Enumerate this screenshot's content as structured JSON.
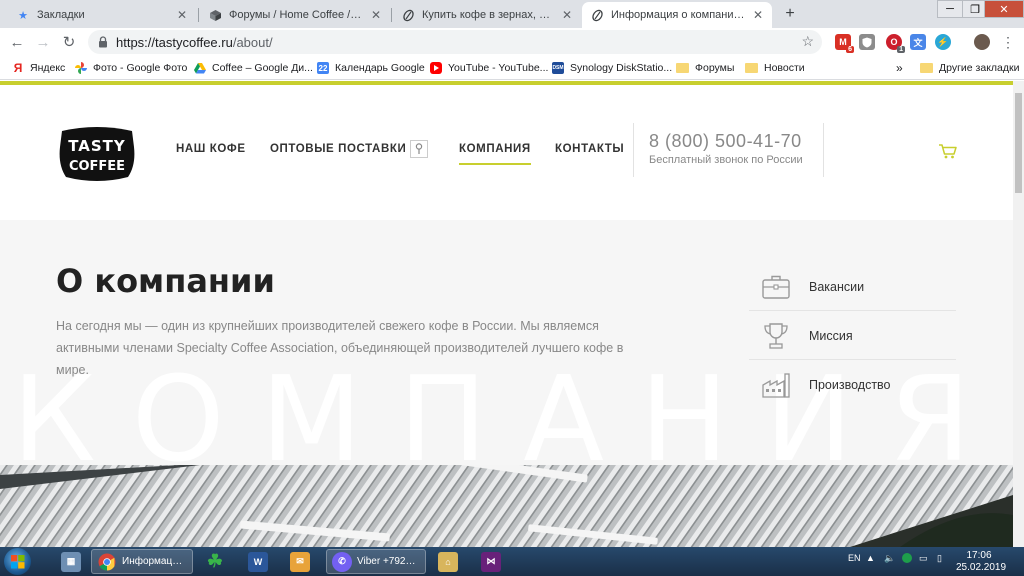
{
  "browser": {
    "tabs": [
      {
        "title": "Закладки",
        "icon": "star-icon"
      },
      {
        "title": "Форумы / Home Coffee / Специ",
        "icon": "forum-icon"
      },
      {
        "title": "Купить кофе в зернах, молотый",
        "icon": "coffee-icon"
      },
      {
        "title": "Информация о компании Tasty",
        "icon": "coffee-icon"
      }
    ],
    "new_tab_label": "+",
    "window_controls": {
      "minimize": "─",
      "maximize": "❐",
      "close": "✕"
    },
    "url_host": "https://tastycoffee.ru",
    "url_path": "/about/",
    "extensions": [
      {
        "name": "gmail-icon",
        "badge": "6",
        "color": "#d93025"
      },
      {
        "name": "shield-icon",
        "badge": "",
        "color": "#8c8c8c"
      },
      {
        "name": "opera-icon",
        "badge": "1",
        "color": "#cc1f2c"
      },
      {
        "name": "translate-icon",
        "badge": "",
        "color": "#4a86e8"
      },
      {
        "name": "lightning-icon",
        "badge": "",
        "color": "#2aa7d6"
      }
    ],
    "bookmarks": [
      {
        "label": "Яндекс",
        "icon": "yandex-icon",
        "color": "#e52620"
      },
      {
        "label": "Фото - Google Фото",
        "icon": "google-photos-icon",
        "color": "#fbbc05"
      },
      {
        "label": "Coffee – Google Ди...",
        "icon": "google-drive-icon",
        "color": "#0f9d58"
      },
      {
        "label": "Календарь Google",
        "icon": "calendar-icon",
        "color": "#4285f4"
      },
      {
        "label": "YouTube - YouTube...",
        "icon": "youtube-icon",
        "color": "#ff0000"
      },
      {
        "label": "Synology DiskStatio...",
        "icon": "synology-icon",
        "color": "#1f4c99"
      },
      {
        "label": "Форумы",
        "icon": "folder-icon",
        "color": "#f7d774"
      },
      {
        "label": "Новости",
        "icon": "folder-icon",
        "color": "#f7d774"
      }
    ],
    "bookmarks_overflow": "»",
    "other_bookmarks": "Другие закладки"
  },
  "site": {
    "logo_text": [
      "TASTY",
      "COFFEE"
    ],
    "nav": [
      {
        "label": "НАШ КОФЕ",
        "active": false
      },
      {
        "label": "ОПТОВЫЕ ПОСТАВКИ",
        "active": false
      },
      {
        "label": "КОМПАНИЯ",
        "active": true
      },
      {
        "label": "КОНТАКТЫ",
        "active": false
      }
    ],
    "phone": "8 (800) 500-41-70",
    "phone_note": "Бесплатный звонок по России",
    "accent_color": "#c8cf2e",
    "title": "О компании",
    "intro": "На сегодня мы — один из крупнейших производителей свежего кофе в России. Мы являемся активными членами Specialty Coffee Association, объединяющей производителей лучшего кофе в мире.",
    "watermark": "КОМПАНИЯ",
    "side_links": [
      {
        "label": "Вакансии",
        "icon": "briefcase-icon"
      },
      {
        "label": "Миссия",
        "icon": "trophy-icon"
      },
      {
        "label": "Производство",
        "icon": "factory-icon"
      }
    ]
  },
  "taskbar": {
    "buttons": [
      {
        "label": "",
        "icon": "calculator-icon",
        "color": "#6e8fb3"
      },
      {
        "label": "Информация ...",
        "icon": "chrome-icon",
        "color": "#4285f4"
      },
      {
        "label": "",
        "icon": "clover-icon",
        "color": "#2e9d3b"
      },
      {
        "label": "",
        "icon": "word-icon",
        "color": "#2b579a"
      },
      {
        "label": "",
        "icon": "mail-icon",
        "color": "#e8a33a"
      },
      {
        "label": "Viber +79262...",
        "icon": "viber-icon",
        "color": "#7360f2"
      },
      {
        "label": "",
        "icon": "map-icon",
        "color": "#d8b55c"
      },
      {
        "label": "",
        "icon": "visual-studio-icon",
        "color": "#68217a"
      }
    ],
    "language": "EN",
    "time": "17:06",
    "date": "25.02.2019"
  }
}
